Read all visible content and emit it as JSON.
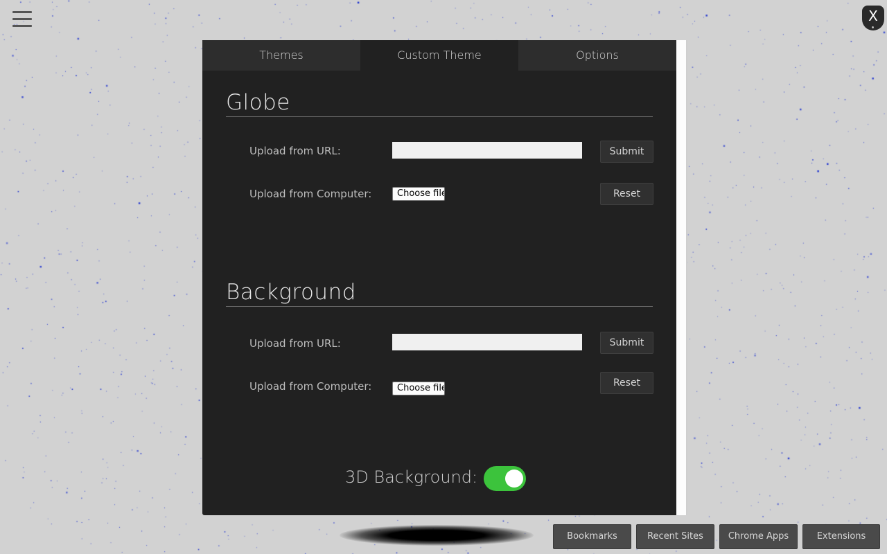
{
  "window": {
    "close_label": "X"
  },
  "tabs": [
    {
      "label": "Themes"
    },
    {
      "label": "Custom Theme"
    },
    {
      "label": "Options"
    }
  ],
  "globe": {
    "title": "Globe",
    "url_label": "Upload from URL:",
    "url_value": "",
    "computer_label": "Upload from Computer:",
    "choose_file_label": "Choose file",
    "submit_label": "Submit",
    "reset_label": "Reset"
  },
  "background": {
    "title": "Background",
    "url_label": "Upload from URL:",
    "url_value": "",
    "computer_label": "Upload from Computer:",
    "choose_file_label": "Choose file",
    "submit_label": "Submit",
    "reset_label": "Reset"
  },
  "toggle_3d": {
    "label": "3D Background:",
    "enabled": true,
    "on_color": "#3cc33c"
  },
  "bottom_nav": [
    {
      "label": "Bookmarks"
    },
    {
      "label": "Recent Sites"
    },
    {
      "label": "Chrome Apps"
    },
    {
      "label": "Extensions"
    }
  ],
  "colors": {
    "page_background": "#d2d2d2",
    "star_color": "#1a2fd0",
    "panel_background": "#212121"
  }
}
